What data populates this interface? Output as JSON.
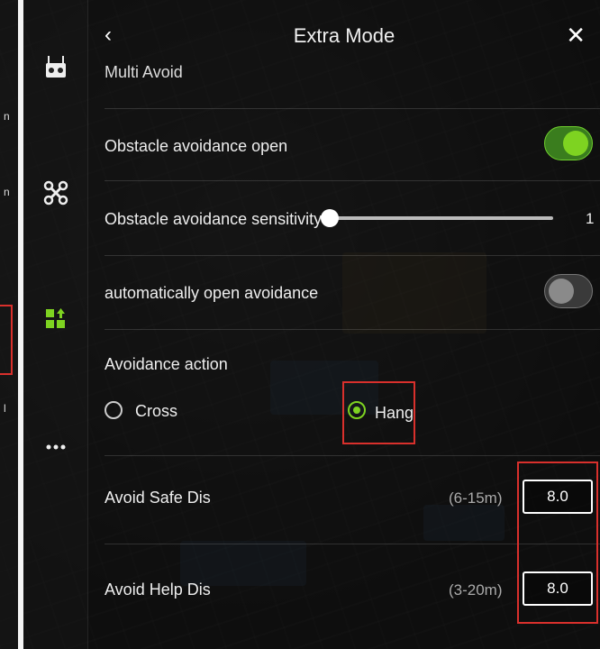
{
  "header": {
    "title": "Extra Mode"
  },
  "section": {
    "label": "Multi Avoid"
  },
  "settings": {
    "obstacle_open": {
      "label": "Obstacle avoidance open",
      "state": "on"
    },
    "sensitivity": {
      "label": "Obstacle avoidance sensitivity",
      "value": "1",
      "level": 0
    },
    "auto_open": {
      "label": "automatically open avoidance",
      "state": "off"
    },
    "avoidance_action": {
      "label": "Avoidance action",
      "options": [
        "Cross",
        "Hang"
      ],
      "selected": "Hang"
    },
    "safe_dis": {
      "label": "Avoid Safe Dis",
      "range": "(6-15m)",
      "value": "8.0"
    },
    "help_dis": {
      "label": "Avoid Help Dis",
      "range": "(3-20m)",
      "value": "8.0"
    }
  },
  "rail": {
    "icons": [
      "remote-controller-icon",
      "drone-icon",
      "grid-apps-icon",
      "more-icon"
    ]
  },
  "colors": {
    "accent_green": "#7ed321",
    "highlight_red": "#d9302c"
  }
}
